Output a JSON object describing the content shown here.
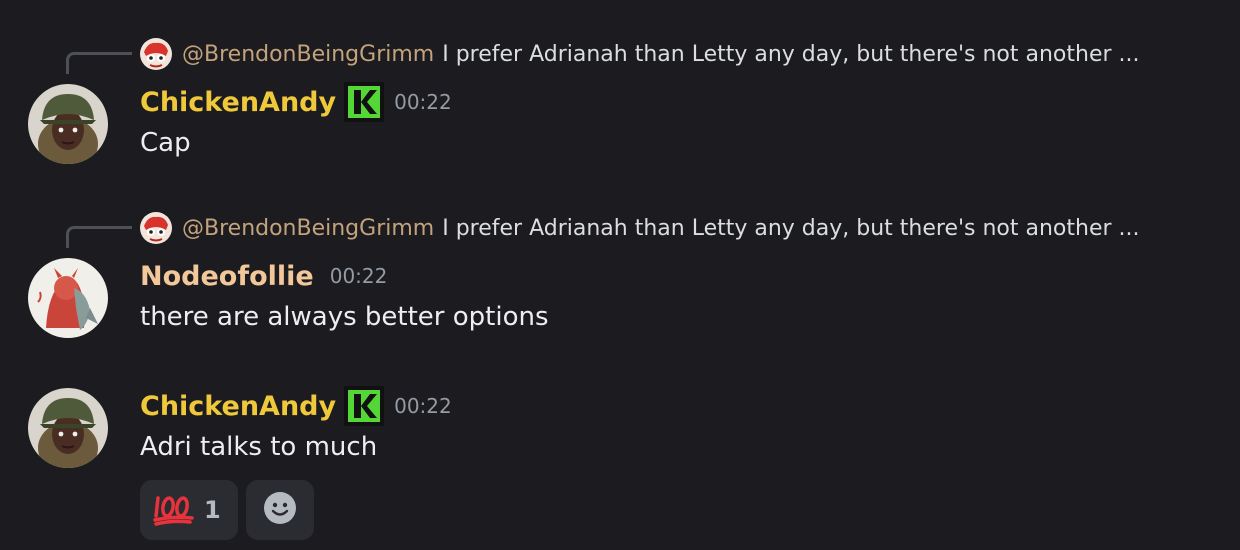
{
  "messages": [
    {
      "reply": {
        "author": "@BrendonBeingGrimm",
        "text": "I prefer Adrianah than Letty any day, but there's not another ..."
      },
      "author": "ChickenAndy",
      "author_color": "#f0c93b",
      "time": "00:22",
      "content": "Cap"
    },
    {
      "reply": {
        "author": "@BrendonBeingGrimm",
        "text": "I prefer Adrianah than Letty any day, but there's not another ..."
      },
      "author": "Nodeofollie",
      "author_color": "#f2c79a",
      "time": "00:22",
      "content": "there are always better options"
    },
    {
      "author": "ChickenAndy",
      "author_color": "#f0c93b",
      "time": "00:22",
      "content": "Adri talks to much",
      "reactions": [
        {
          "emoji": "hundred-points-emoji",
          "count": "1"
        }
      ],
      "add_reaction_icon": "add-reaction-icon"
    }
  ],
  "colors": {
    "background": "#1b1b20",
    "reply_author": "#c3a37c",
    "timestamp": "#949ba4",
    "text": "#eceef0",
    "reaction_bg": "#2b2c31"
  }
}
